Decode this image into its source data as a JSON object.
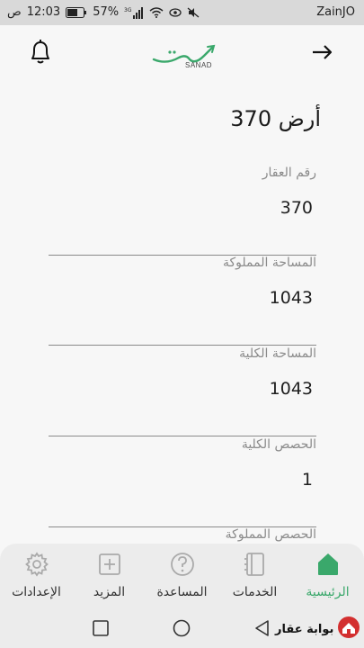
{
  "status_bar": {
    "carrier": "ZainJO",
    "time": "12:03",
    "ampm": "ص",
    "battery": "57%",
    "network": "3G"
  },
  "header": {
    "logo_arabic": "سند",
    "logo_text": "SANAD"
  },
  "content": {
    "title": "أرض 370",
    "fields": [
      {
        "label": "رقم العقار",
        "value": "370"
      },
      {
        "label": "المساحة المملوكة",
        "value": "1043"
      },
      {
        "label": "المساحة الكلية",
        "value": "1043"
      },
      {
        "label": "الحصص الكلية",
        "value": "1"
      },
      {
        "label": "الحصص المملوكة",
        "value": ""
      }
    ]
  },
  "bottom_nav": [
    {
      "label": "الرئيسية",
      "icon": "home-icon",
      "active": true
    },
    {
      "label": "الخدمات",
      "icon": "services-icon",
      "active": false
    },
    {
      "label": "المساعدة",
      "icon": "help-icon",
      "active": false
    },
    {
      "label": "المزيد",
      "icon": "plus-icon",
      "active": false
    },
    {
      "label": "الإعدادات",
      "icon": "gear-icon",
      "active": false
    }
  ],
  "watermark": "بوابة عقار",
  "colors": {
    "accent": "#3aa86b",
    "text": "#1a1a1a",
    "muted": "#8a8a8a"
  }
}
